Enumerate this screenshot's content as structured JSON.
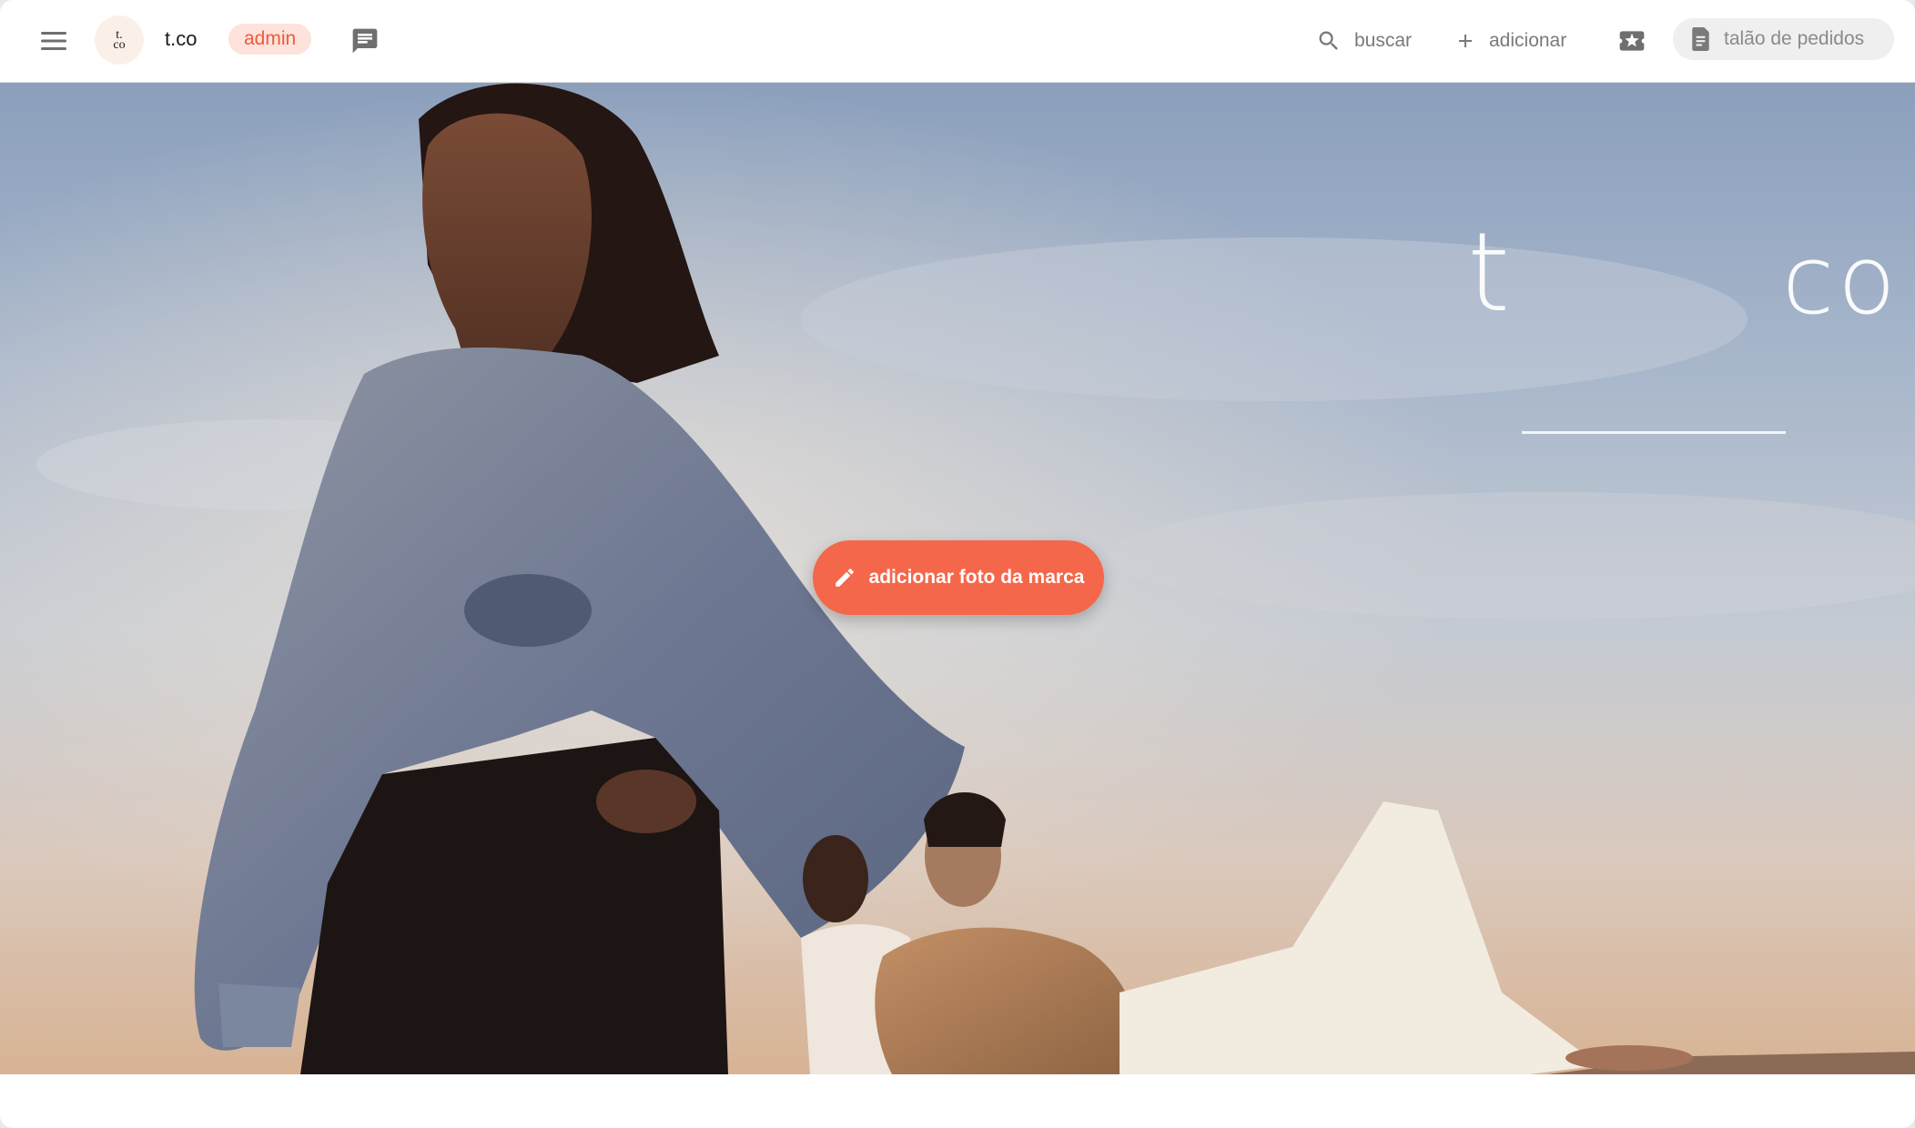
{
  "topbar": {
    "menu_icon": "hamburger-menu-icon",
    "logo_line1": "t.",
    "logo_line2": "co",
    "brand_name": "t.co",
    "admin_badge": "admin",
    "chat_icon": "chat-icon",
    "search_label": "buscar",
    "add_label": "adicionar",
    "ticket_icon": "star-ticket-icon",
    "orders_label": "talão de pedidos"
  },
  "hero": {
    "logo_t": "t",
    "logo_co": "co",
    "add_photo_label": "adicionar foto da marca"
  },
  "colors": {
    "accent": "#f5674a",
    "badge_bg": "#fde3db",
    "badge_text": "#f05a3c",
    "icon_gray": "#6f6f6f"
  }
}
